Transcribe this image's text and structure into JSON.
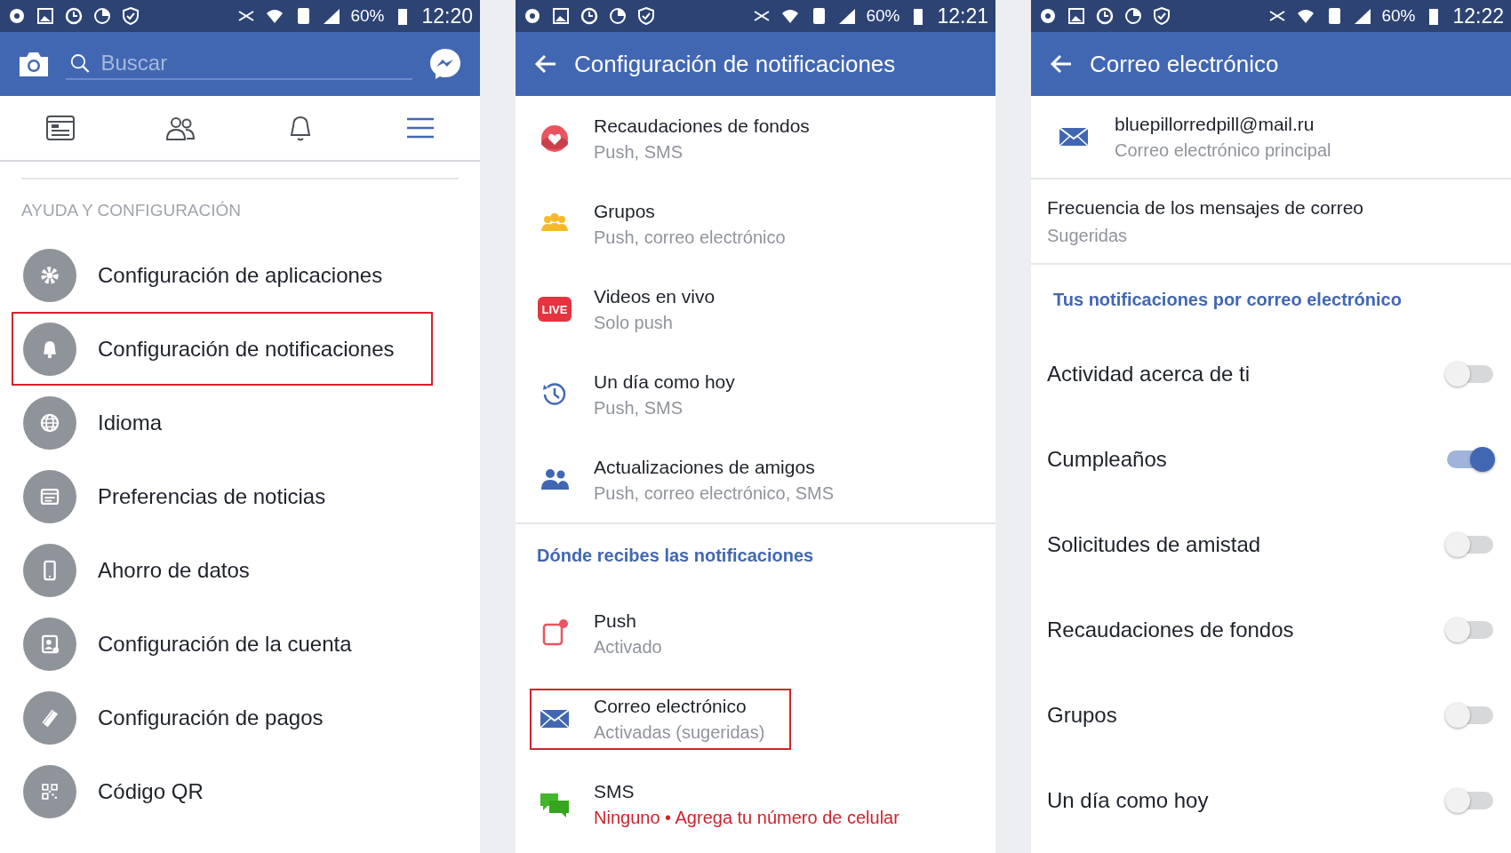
{
  "screens": [
    {
      "status_bar": {
        "battery": "60%",
        "time": "12:20"
      },
      "search": {
        "placeholder": "Buscar"
      },
      "tabs": [
        {
          "selected": false
        },
        {
          "selected": false
        },
        {
          "selected": false
        },
        {
          "selected": true
        }
      ],
      "section": "AYUDA Y CONFIGURACIÓN",
      "items": [
        {
          "label": "Configuración de aplicaciones",
          "highlighted": false
        },
        {
          "label": "Configuración de notificaciones",
          "highlighted": true
        },
        {
          "label": "Idioma",
          "highlighted": false
        },
        {
          "label": "Preferencias de noticias",
          "highlighted": false
        },
        {
          "label": "Ahorro de datos",
          "highlighted": false
        },
        {
          "label": "Configuración de la cuenta",
          "highlighted": false
        },
        {
          "label": "Configuración de pagos",
          "highlighted": false
        },
        {
          "label": "Código QR",
          "highlighted": false
        }
      ]
    },
    {
      "status_bar": {
        "battery": "60%",
        "time": "12:21"
      },
      "title": "Configuración de notificaciones",
      "items": [
        {
          "title": "Recaudaciones de fondos",
          "subtitle": "Push, SMS",
          "highlighted": false,
          "error": false
        },
        {
          "title": "Grupos",
          "subtitle": "Push, correo electrónico",
          "highlighted": false,
          "error": false
        },
        {
          "title": "Videos en vivo",
          "subtitle": "Solo push",
          "highlighted": false,
          "error": false,
          "badge": "LIVE"
        },
        {
          "title": "Un día como hoy",
          "subtitle": "Push, SMS",
          "highlighted": false,
          "error": false
        },
        {
          "title": "Actualizaciones de amigos",
          "subtitle": "Push, correo electrónico, SMS",
          "highlighted": false,
          "error": false
        }
      ],
      "section": "Dónde recibes las notificaciones",
      "channels": [
        {
          "title": "Push",
          "subtitle": "Activado",
          "highlighted": false,
          "error": false
        },
        {
          "title": "Correo electrónico",
          "subtitle": "Activadas (sugeridas)",
          "highlighted": true,
          "error": false
        },
        {
          "title": "SMS",
          "subtitle": "Ninguno • Agrega tu número de celular",
          "highlighted": false,
          "error": true
        }
      ]
    },
    {
      "status_bar": {
        "battery": "60%",
        "time": "12:22"
      },
      "title": "Correo electrónico",
      "email": {
        "address": "bluepillorredpill@mail.ru",
        "subtitle": "Correo electrónico principal"
      },
      "frequency": {
        "title": "Frecuencia de los mensajes de correo",
        "value": "Sugeridas"
      },
      "section": "Tus notificaciones por correo electrónico",
      "toggles": [
        {
          "label": "Actividad acerca de ti",
          "on": false
        },
        {
          "label": "Cumpleaños",
          "on": true
        },
        {
          "label": "Solicitudes de amistad",
          "on": false
        },
        {
          "label": "Recaudaciones de fondos",
          "on": false
        },
        {
          "label": "Grupos",
          "on": false
        },
        {
          "label": "Un día como hoy",
          "on": false
        }
      ]
    }
  ]
}
